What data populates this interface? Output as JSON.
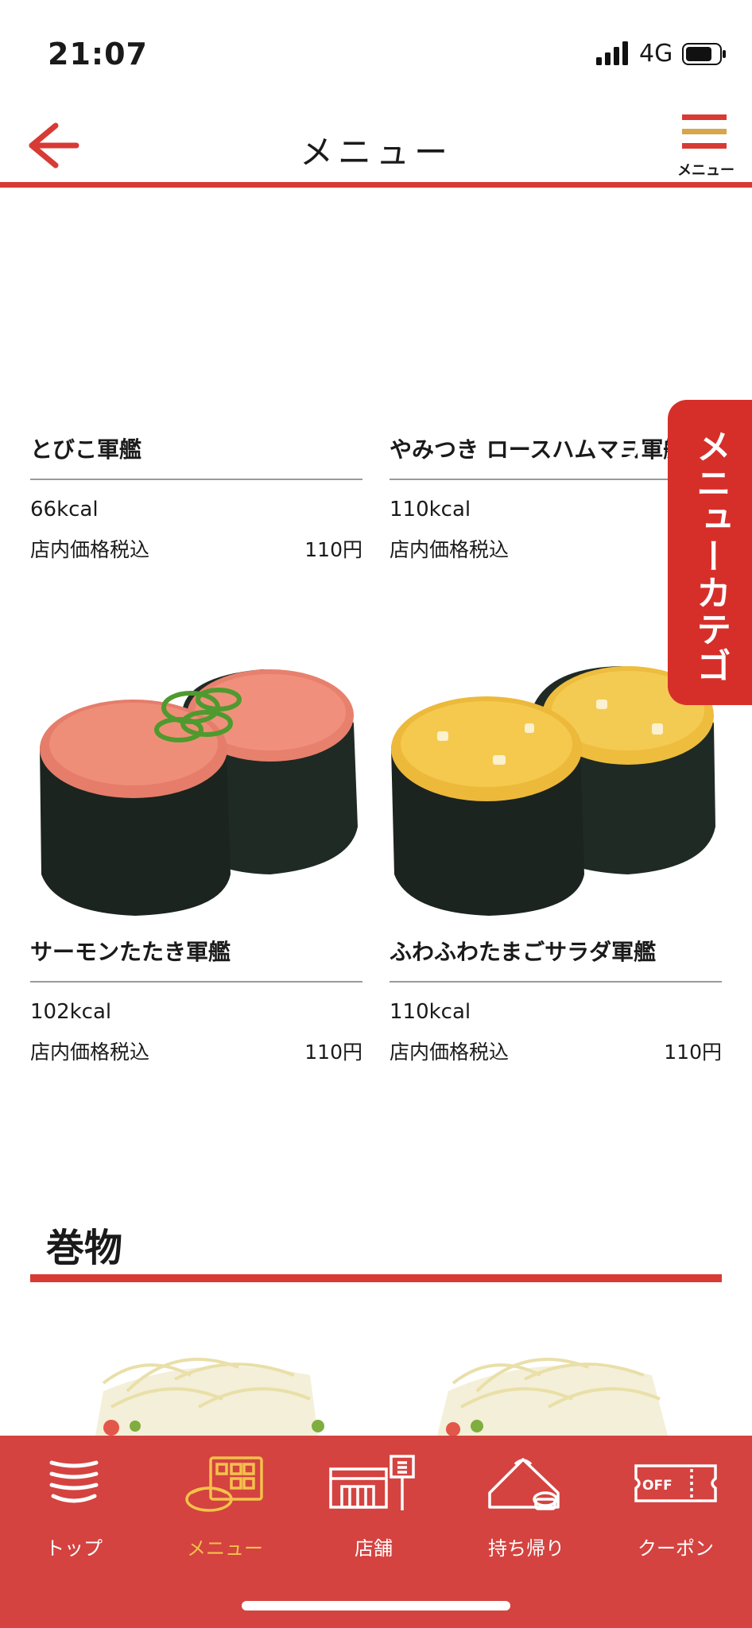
{
  "status_bar": {
    "time": "21:07",
    "network": "4G"
  },
  "header": {
    "title": "メニュー",
    "menu_label": "メニュー"
  },
  "products": [
    {
      "name": "とびこ軍艦",
      "kcal": "66kcal",
      "price_label": "店内価格税込",
      "price": "110円"
    },
    {
      "name": "やみつき ロースハムマヨ軍艦",
      "kcal": "110kcal",
      "price_label": "店内価格税込",
      "price": ""
    },
    {
      "name": "サーモンたたき軍艦",
      "kcal": "102kcal",
      "price_label": "店内価格税込",
      "price": "110円"
    },
    {
      "name": "ふわふわたまごサラダ軍艦",
      "kcal": "110kcal",
      "price_label": "店内価格税込",
      "price": "110円"
    }
  ],
  "category_tab": {
    "label": "メニューカテゴリ"
  },
  "section": {
    "title": "巻物"
  },
  "bottom_nav": [
    {
      "label": "トップ",
      "icon": "plates-icon",
      "active": false
    },
    {
      "label": "メニュー",
      "icon": "menu-sushi-icon",
      "active": true
    },
    {
      "label": "店舗",
      "icon": "store-icon",
      "active": false
    },
    {
      "label": "持ち帰り",
      "icon": "takeout-icon",
      "active": false
    },
    {
      "label": "クーポン",
      "icon": "coupon-icon",
      "active": false
    }
  ],
  "colors": {
    "brand_red": "#d83a34",
    "nav_bg": "#d44340",
    "active_nav": "#f3c24a",
    "menu_gold": "#d6a64b"
  }
}
